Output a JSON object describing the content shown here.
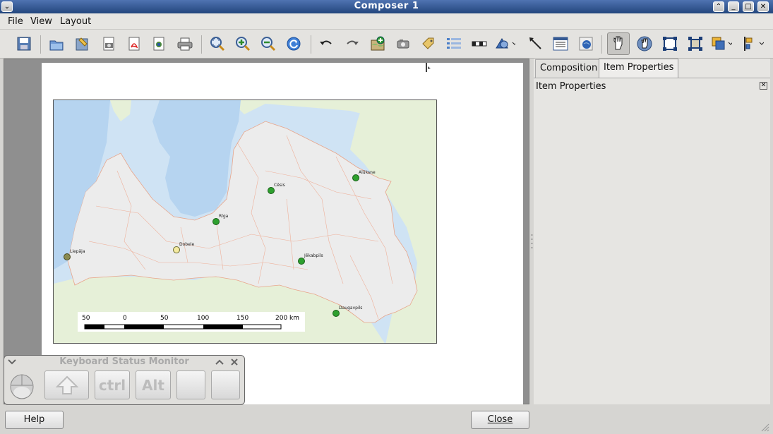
{
  "window": {
    "title": "Composer 1"
  },
  "menu": [
    "File",
    "View",
    "Layout"
  ],
  "toolbar": {
    "icons": [
      "save-icon",
      "open-template-icon",
      "save-template-icon",
      "export-image-icon",
      "export-pdf-icon",
      "export-svg-icon",
      "print-icon",
      "zoom-full-icon",
      "zoom-in-icon",
      "zoom-out-icon",
      "refresh-icon",
      "undo-icon",
      "redo-icon",
      "add-map-icon",
      "add-image-icon",
      "add-label-icon",
      "add-legend-icon",
      "add-scalebar-icon",
      "add-shape-icon",
      "add-arrow-icon",
      "add-table-icon",
      "add-html-icon",
      "select-move-icon",
      "move-content-icon",
      "group-icon",
      "ungroup-icon",
      "raise-icon",
      "align-icon"
    ]
  },
  "panel": {
    "tabs": [
      "Composition",
      "Item Properties"
    ],
    "active_tab": "Item Properties",
    "title": "Item Properties"
  },
  "map": {
    "places": [
      {
        "name": "Alūksne"
      },
      {
        "name": "Cēsis"
      },
      {
        "name": "Rīga"
      },
      {
        "name": "Dobele"
      },
      {
        "name": "Liepāja"
      },
      {
        "name": "Jēkabpils"
      },
      {
        "name": "Daugavpils"
      }
    ],
    "scalebar": {
      "labels": [
        "50",
        "0",
        "50",
        "100",
        "150",
        "200 km"
      ]
    }
  },
  "buttons": {
    "help": "Help",
    "close": "Close"
  },
  "ksm": {
    "title": "Keyboard Status Monitor",
    "keys": [
      "",
      "ctrl",
      "Alt",
      "",
      ""
    ]
  }
}
